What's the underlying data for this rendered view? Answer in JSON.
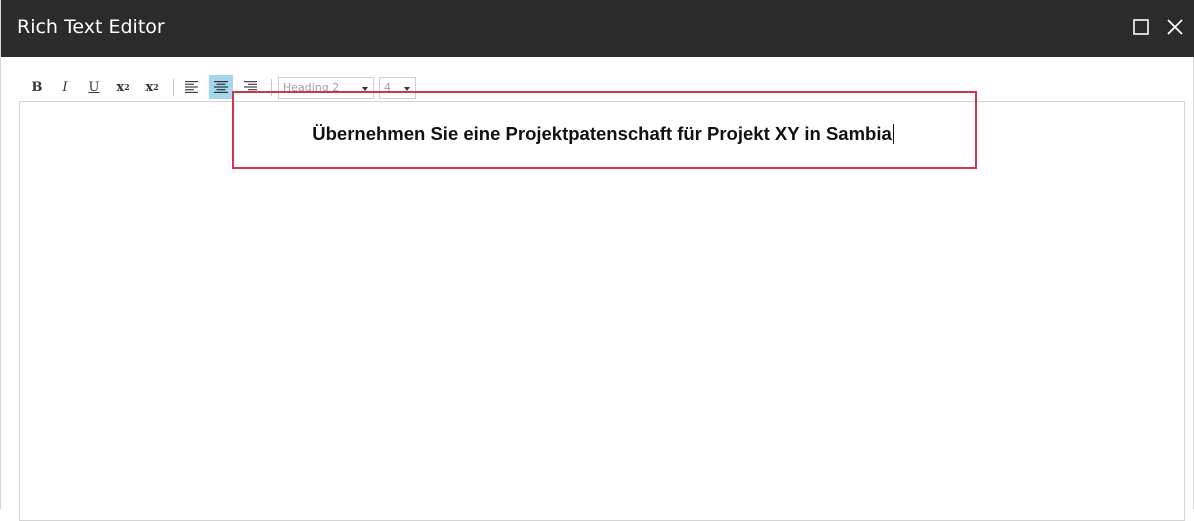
{
  "window": {
    "title": "Rich Text Editor",
    "maximize_icon": "maximize-icon",
    "close_icon": "close-icon"
  },
  "toolbar": {
    "bold_label": "B",
    "italic_label": "I",
    "underline_label": "U",
    "subscript_label": "x",
    "subscript_mark": "2",
    "superscript_label": "x",
    "superscript_mark": "2",
    "icons": [
      "align-left-icon",
      "align-center-icon",
      "align-right-icon"
    ],
    "active_alignment": "center",
    "heading_select": {
      "value": "Heading 2"
    },
    "size_select": {
      "value": "4"
    }
  },
  "editor": {
    "content": "Übernehmen Sie eine Projektpatenschaft für Projekt XY in Sambia"
  },
  "colors": {
    "titlebar": "#2b2b2b",
    "active_button": "#a6d7f0",
    "highlight_box": "#d2344c"
  }
}
